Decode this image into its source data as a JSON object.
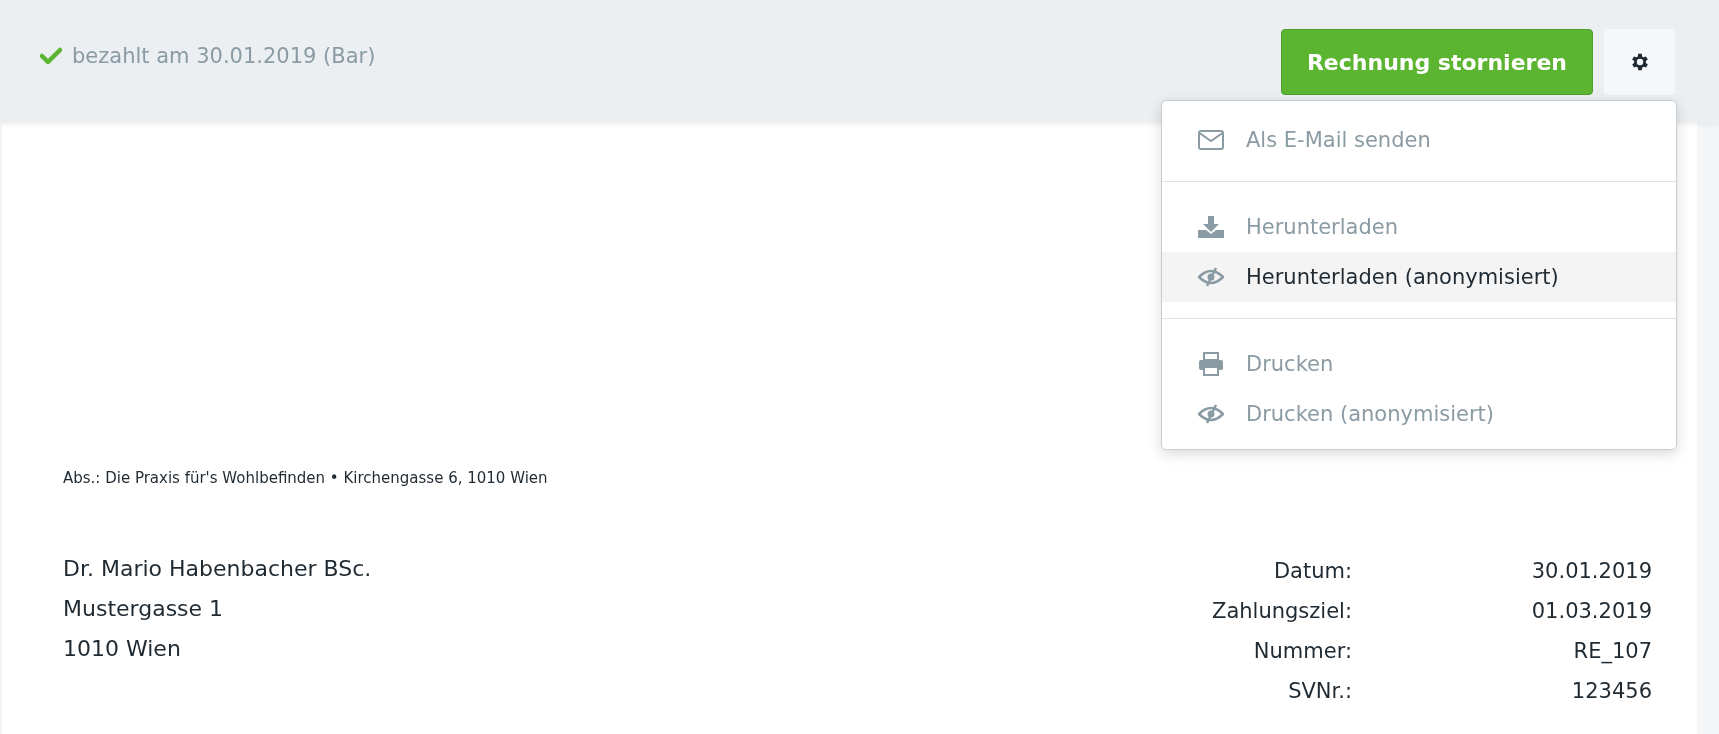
{
  "status": {
    "paid": true,
    "text": "bezahlt am 30.01.2019 (Bar)"
  },
  "cancel_button": "Rechnung stornieren",
  "menu": {
    "open": true,
    "groups": [
      [
        {
          "kind": "email",
          "label": "Als E-Mail senden",
          "selected": false
        }
      ],
      [
        {
          "kind": "download",
          "label": "Herunterladen",
          "selected": false
        },
        {
          "kind": "anonymous",
          "label": "Herunterladen (anonymisiert)",
          "selected": true
        }
      ],
      [
        {
          "kind": "print",
          "label": "Drucken",
          "selected": false
        },
        {
          "kind": "anonymous",
          "label": "Drucken (anonymisiert)",
          "selected": false
        }
      ]
    ]
  },
  "sender_line": "Abs.: Die Praxis für's Wohlbefinden • Kirchengasse 6, 1010 Wien",
  "recipient": [
    "Dr. Mario Habenbacher BSc.",
    "Mustergasse 1",
    "1010 Wien"
  ],
  "details": [
    {
      "label": "Datum:",
      "value": "30.01.2019"
    },
    {
      "label": "Zahlungsziel:",
      "value": "01.03.2019"
    },
    {
      "label": "Nummer:",
      "value": "RE_107"
    },
    {
      "label": "SVNr.:",
      "value": "123456"
    }
  ]
}
